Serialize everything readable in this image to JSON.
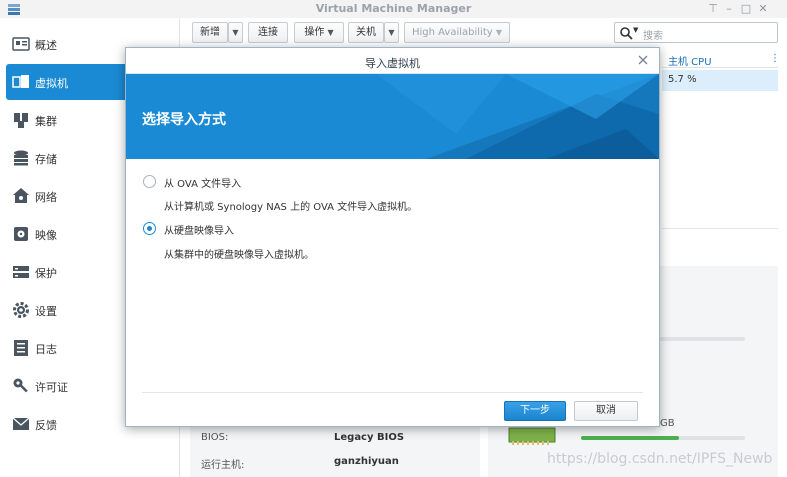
{
  "window": {
    "title": "Virtual Machine Manager"
  },
  "sidebar": {
    "items": [
      {
        "label": "概述",
        "icon": "overview-icon"
      },
      {
        "label": "虚拟机",
        "icon": "vm-icon",
        "active": true
      },
      {
        "label": "集群",
        "icon": "cluster-icon"
      },
      {
        "label": "存储",
        "icon": "storage-icon"
      },
      {
        "label": "网络",
        "icon": "network-icon"
      },
      {
        "label": "映像",
        "icon": "image-icon"
      },
      {
        "label": "保护",
        "icon": "protection-icon"
      },
      {
        "label": "设置",
        "icon": "settings-icon"
      },
      {
        "label": "日志",
        "icon": "log-icon"
      },
      {
        "label": "许可证",
        "icon": "license-icon"
      },
      {
        "label": "反馈",
        "icon": "feedback-icon"
      }
    ]
  },
  "toolbar": {
    "new_label": "新增",
    "connect_label": "连接",
    "action_label": "操作",
    "shutdown_label": "关机",
    "ha_label": "High Availability"
  },
  "search": {
    "placeholder": "搜索"
  },
  "table": {
    "column_cpu": "主机 CPU",
    "row_cpu": "5.7 %"
  },
  "details": {
    "bios_label": "BIOS:",
    "bios_value": "Legacy BIOS",
    "host_label": "运行主机:",
    "host_value": "ganzhiyuan",
    "mem_unit": "GB",
    "mem_progress": 0.6
  },
  "modal": {
    "title": "导入虚拟机",
    "heading": "选择导入方式",
    "options": [
      {
        "label": "从 OVA 文件导入",
        "desc": "从计算机或 Synology NAS 上的 OVA 文件导入虚拟机。",
        "selected": false
      },
      {
        "label": "从硬盘映像导入",
        "desc": "从集群中的硬盘映像导入虚拟机。",
        "selected": true
      }
    ],
    "next_label": "下一步",
    "cancel_label": "取消"
  },
  "watermark": "https://blog.csdn.net/IPFS_Newb",
  "colors": {
    "accent": "#1a8ad4",
    "banner": "#1a8ad4"
  }
}
